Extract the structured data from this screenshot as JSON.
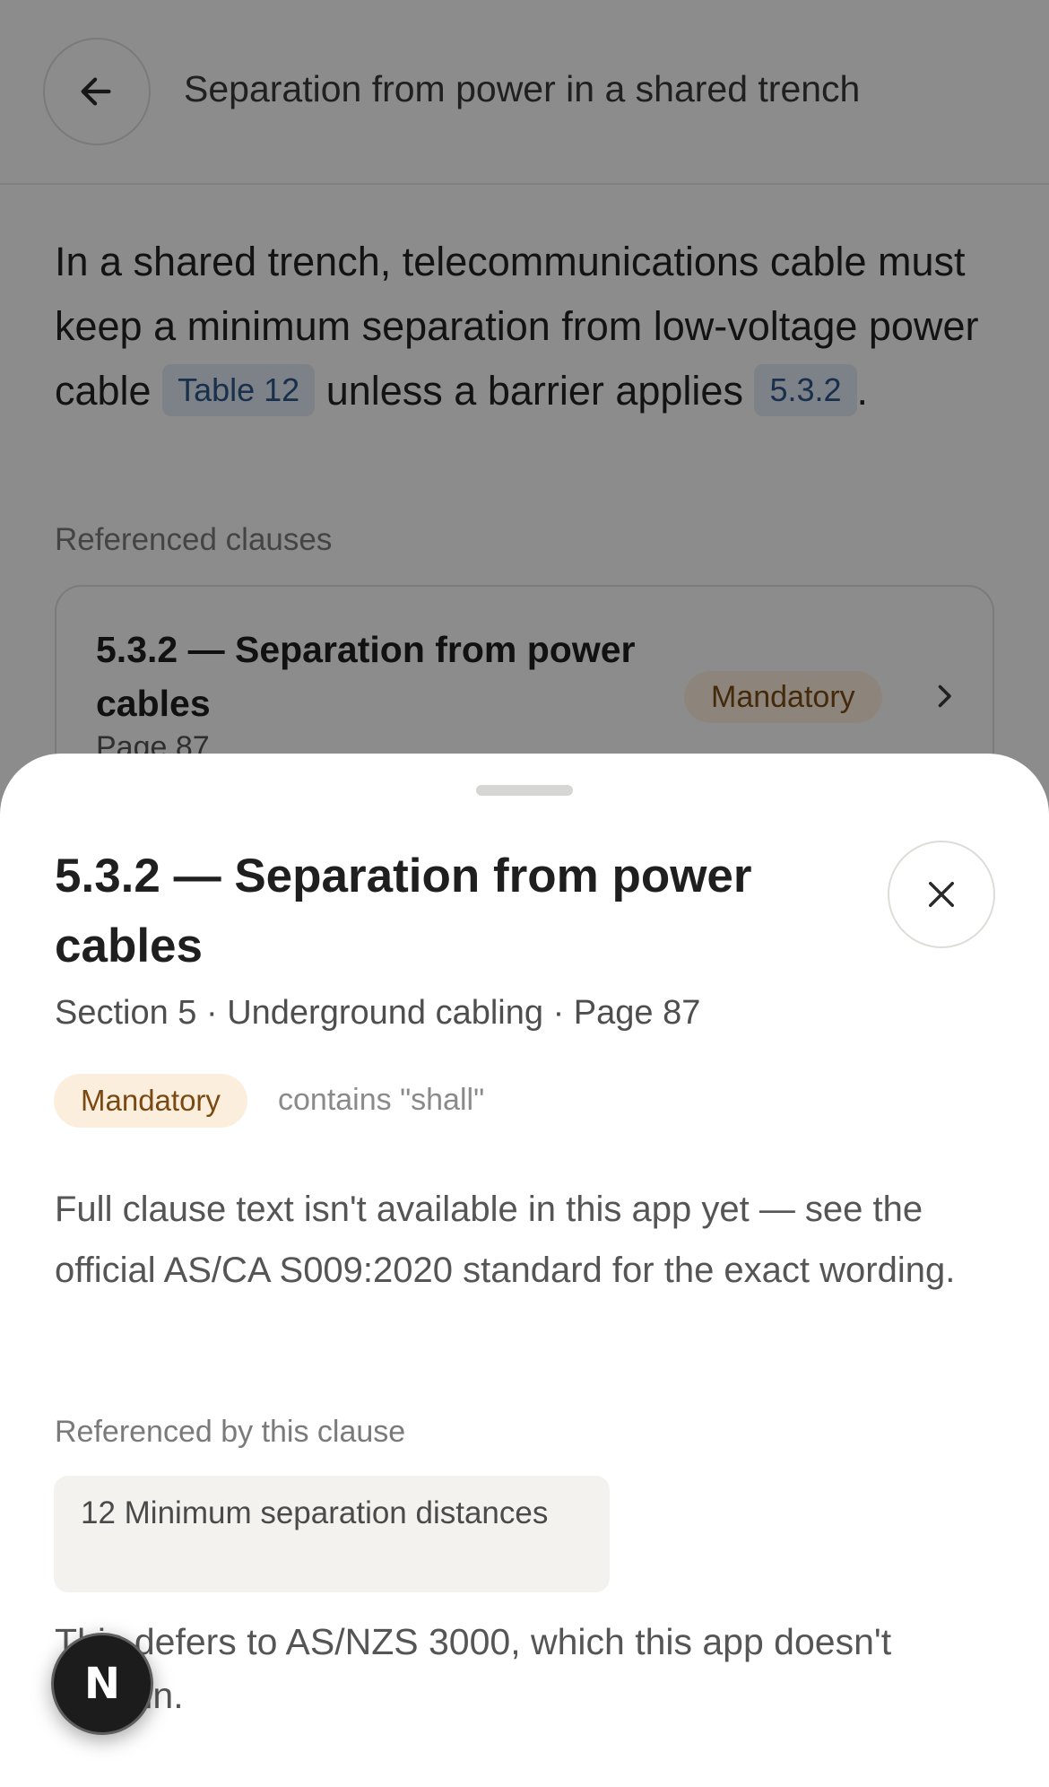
{
  "header": {
    "title": "Separation from power in a shared trench",
    "back_icon": "arrow-left-icon"
  },
  "summary": {
    "text_before": "In a shared trench, telecommunications cable must keep a minimum separation from low-voltage power cable ",
    "chip_table": "Table 12",
    "text_middle": " unless a barrier applies ",
    "chip_clause": "5.3.2",
    "text_after": "."
  },
  "referenced_clauses": {
    "label": "Referenced clauses",
    "cards": [
      {
        "title": "5.3.2 — Separation from power cables",
        "page": "Page 87",
        "badge": "Mandatory",
        "chevron_icon": "chevron-right-icon"
      }
    ]
  },
  "sheet": {
    "title": "5.3.2 — Separation from power cables",
    "close_icon": "close-icon",
    "meta": "Section 5 · Underground cabling · Page 87",
    "badge": "Mandatory",
    "badge_note": "contains \"shall\"",
    "body": "Full clause text isn't available in this app yet — see the official AS/CA S009:2020 standard for the exact wording.",
    "referenced_label": "Referenced by this clause",
    "referenced_item": "12 Minimum separation distances",
    "note": "This defers to AS/NZS 3000, which this app doesn't contain."
  },
  "fab": {
    "letter": "N"
  },
  "colors": {
    "chip_bg": "#dfe7f3",
    "chip_text": "#2d5688",
    "mandatory_bg": "#fbeedd",
    "mandatory_text": "#7a4a12",
    "scrim": "rgba(0,0,0,0.44)"
  }
}
